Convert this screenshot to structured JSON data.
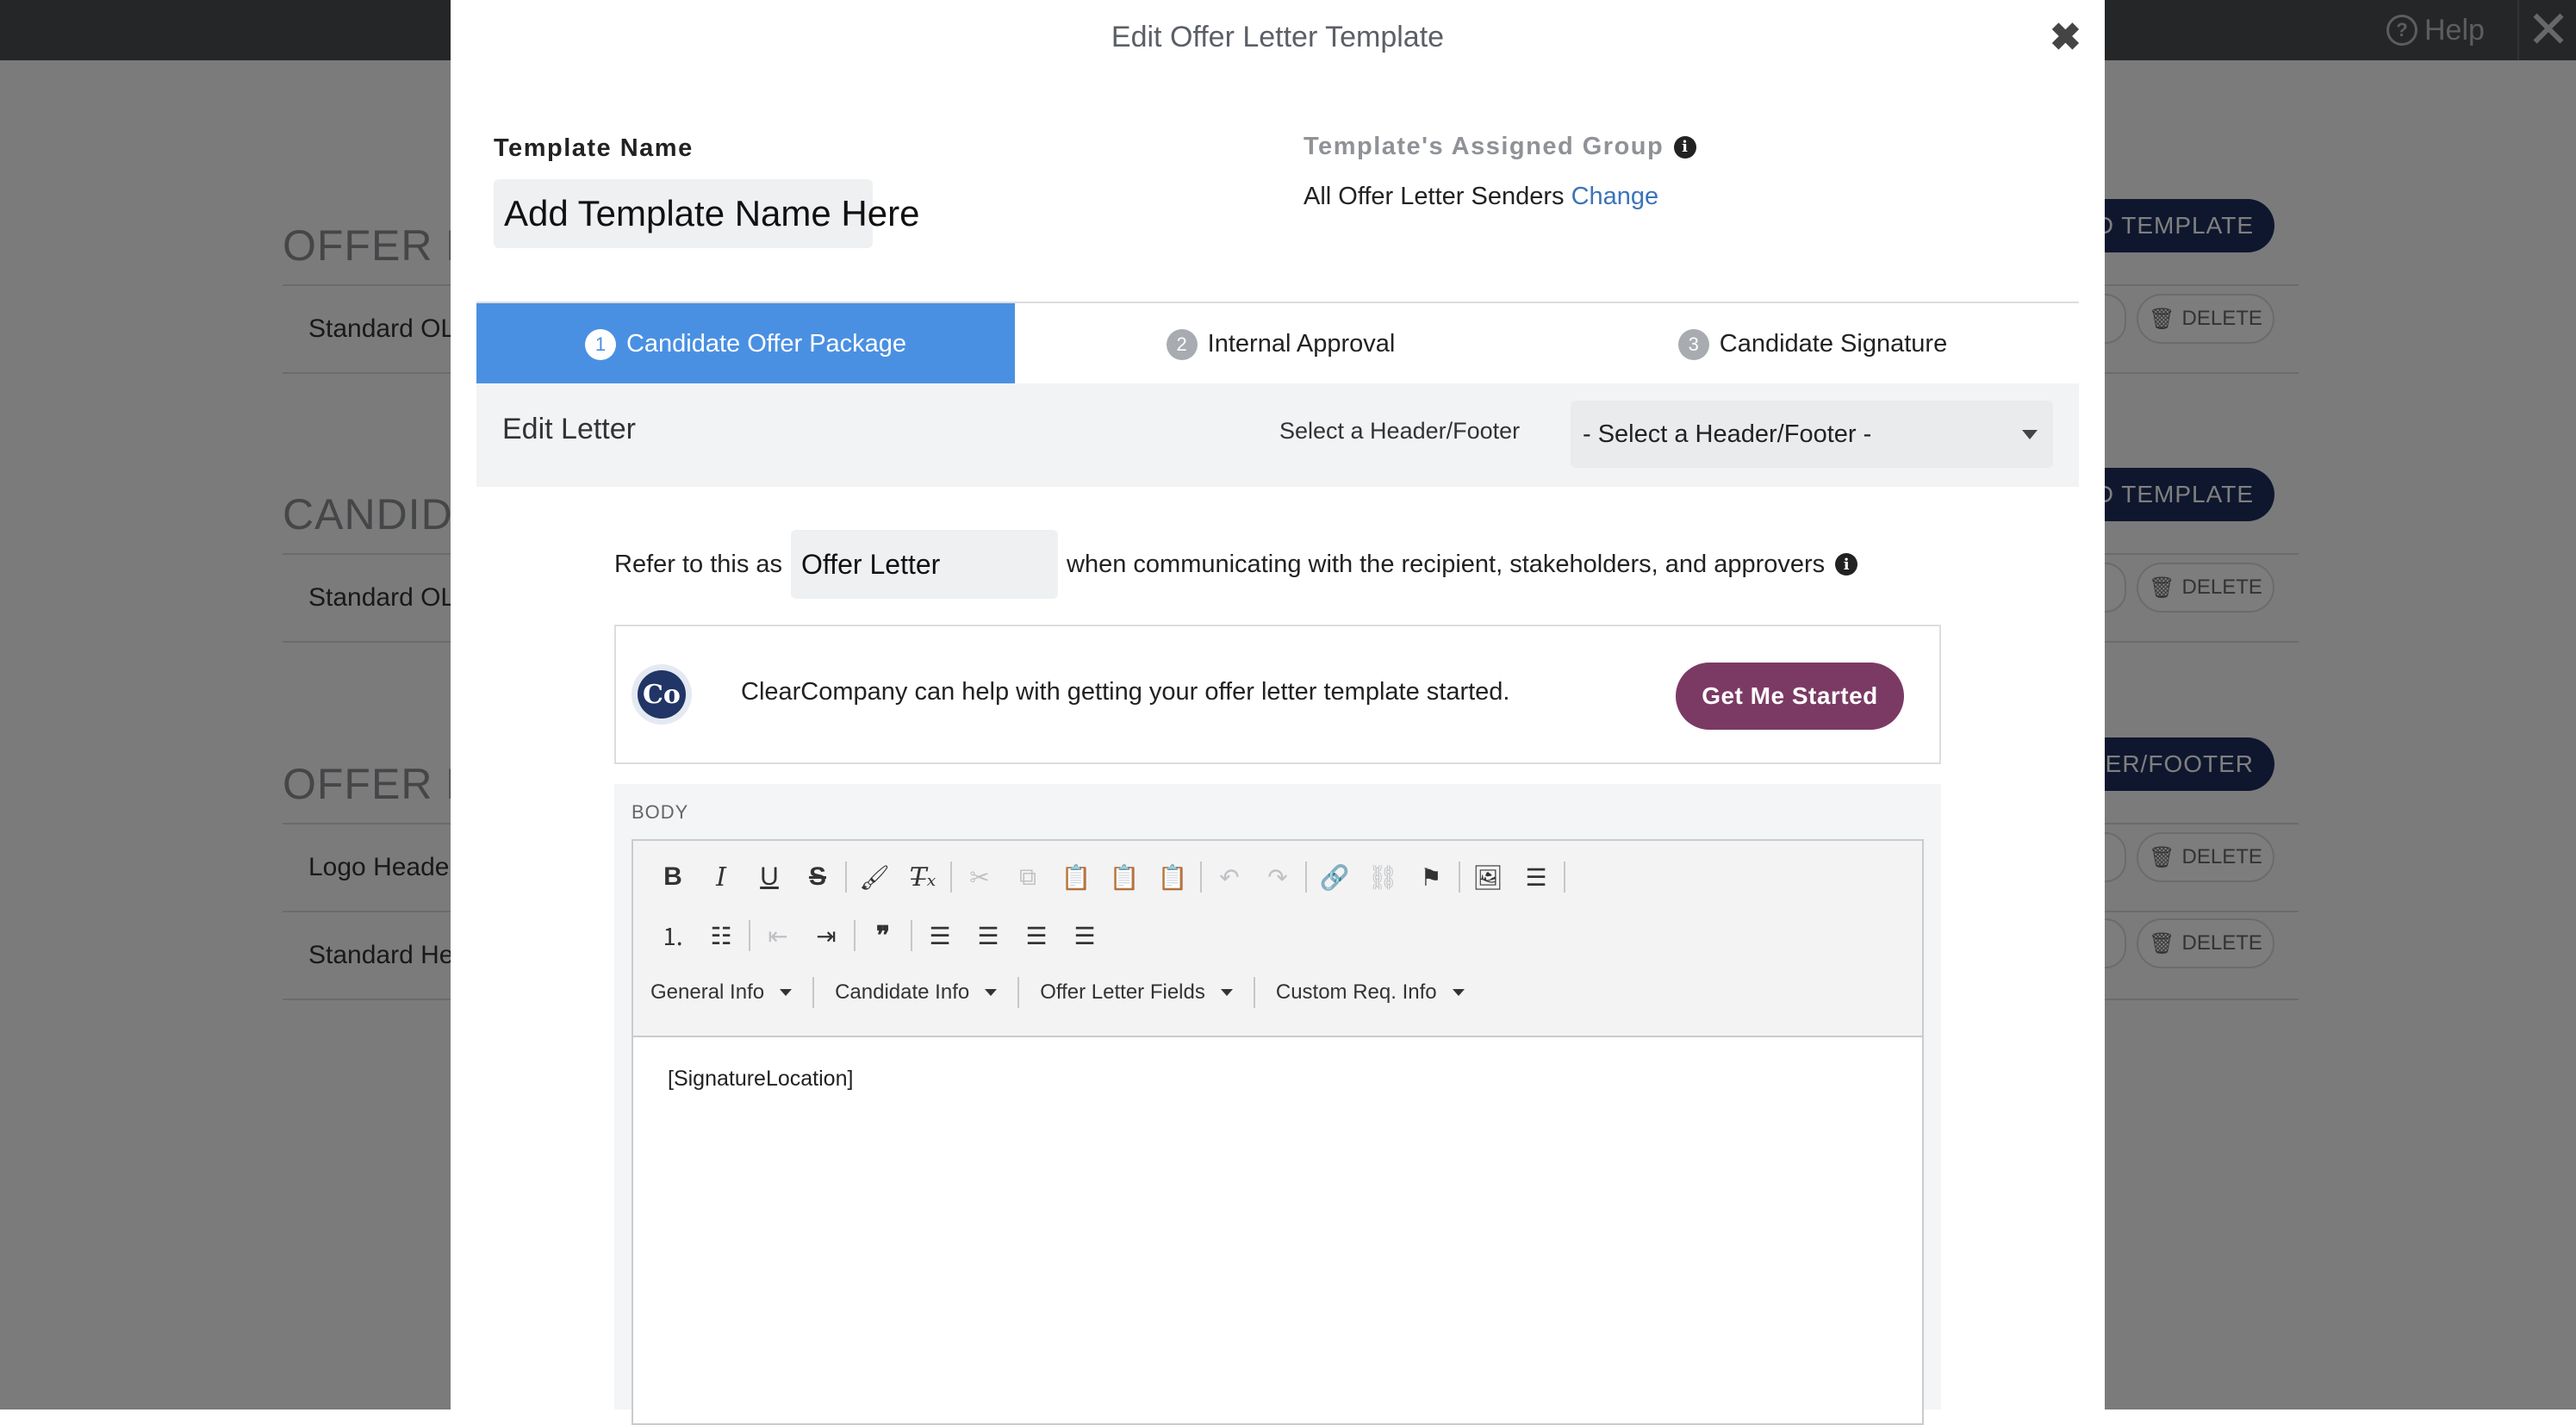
{
  "background": {
    "help_label": "Help",
    "close_label": "✕",
    "sections": [
      {
        "title": "OFFER LE",
        "rows": [
          "Standard OL"
        ],
        "button": "DD TEMPLATE"
      },
      {
        "title": "CANDIDA",
        "rows": [
          "Standard OL"
        ],
        "button": "DD TEMPLATE"
      },
      {
        "title": "OFFER LE",
        "rows": [
          "Logo Header",
          "Standard He"
        ],
        "button": "ADER/FOOTER"
      }
    ],
    "delete_label": "DELETE"
  },
  "modal": {
    "title": "Edit Offer Letter Template",
    "close_label": "✖",
    "template_name_label": "Template Name",
    "template_name_value": "Add Template Name Here",
    "assigned_group_label": "Template's Assigned Group",
    "assigned_group_value": "All Offer Letter Senders",
    "change_link": "Change",
    "tabs": [
      {
        "num": "1",
        "label": "Candidate Offer Package"
      },
      {
        "num": "2",
        "label": "Internal Approval"
      },
      {
        "num": "3",
        "label": "Candidate Signature"
      }
    ],
    "edit_letter_title": "Edit Letter",
    "header_footer_label": "Select a Header/Footer",
    "header_footer_selected": "- Select a Header/Footer -",
    "refer_prefix": "Refer to this as",
    "refer_value": "Offer Letter",
    "refer_suffix": "when communicating with the recipient, stakeholders, and approvers",
    "promo_logo_text": "Co",
    "promo_text": "ClearCompany can help with getting your offer letter template started.",
    "promo_button": "Get Me Started",
    "body_label": "BODY",
    "toolbar_menus": [
      "General Info",
      "Candidate Info",
      "Offer Letter Fields",
      "Custom Req. Info"
    ],
    "toolbar_icons": {
      "bold": "B",
      "italic": "I",
      "underline": "U",
      "strike": "S"
    },
    "editor_content": "[SignatureLocation]"
  }
}
